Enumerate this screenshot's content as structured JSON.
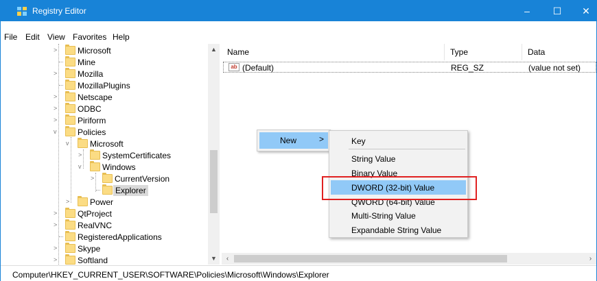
{
  "window": {
    "title": "Registry Editor",
    "titlebar_color": "#1883d7",
    "controls": {
      "minimize": "–",
      "maximize": "☐",
      "close": "✕"
    }
  },
  "menu": [
    "File",
    "Edit",
    "View",
    "Favorites",
    "Help"
  ],
  "tree": {
    "nodes": [
      {
        "label": "Microsoft",
        "expander": ">"
      },
      {
        "label": "Mine",
        "expander": ""
      },
      {
        "label": "Mozilla",
        "expander": ">"
      },
      {
        "label": "MozillaPlugins",
        "expander": ""
      },
      {
        "label": "Netscape",
        "expander": ">"
      },
      {
        "label": "ODBC",
        "expander": ">"
      },
      {
        "label": "Piriform",
        "expander": ">"
      },
      {
        "label": "Policies",
        "expander": "v"
      },
      {
        "label": "Microsoft",
        "expander": "v"
      },
      {
        "label": "SystemCertificates",
        "expander": ">"
      },
      {
        "label": "Windows",
        "expander": "v"
      },
      {
        "label": "CurrentVersion",
        "expander": ">"
      },
      {
        "label": "Explorer",
        "expander": ""
      },
      {
        "label": "Power",
        "expander": ">"
      },
      {
        "label": "QtProject",
        "expander": ">"
      },
      {
        "label": "RealVNC",
        "expander": ">"
      },
      {
        "label": "RegisteredApplications",
        "expander": ""
      },
      {
        "label": "Skype",
        "expander": ">"
      },
      {
        "label": "Softland",
        "expander": ">"
      }
    ],
    "selected": "Explorer"
  },
  "list": {
    "columns": [
      "Name",
      "Type",
      "Data"
    ],
    "rows": [
      {
        "icon": "ab",
        "name": "(Default)",
        "type": "REG_SZ",
        "data": "(value not set)"
      }
    ]
  },
  "context_menu": {
    "new_label": "New",
    "new_arrow": ">",
    "submenu": [
      "Key",
      "String Value",
      "Binary Value",
      "DWORD (32-bit) Value",
      "QWORD (64-bit) Value",
      "Multi-String Value",
      "Expandable String Value"
    ],
    "highlighted": "DWORD (32-bit) Value",
    "highlight_color": "#91c9f7",
    "annotation_color": "#e02020"
  },
  "status": {
    "path": "Computer\\HKEY_CURRENT_USER\\SOFTWARE\\Policies\\Microsoft\\Windows\\Explorer"
  }
}
